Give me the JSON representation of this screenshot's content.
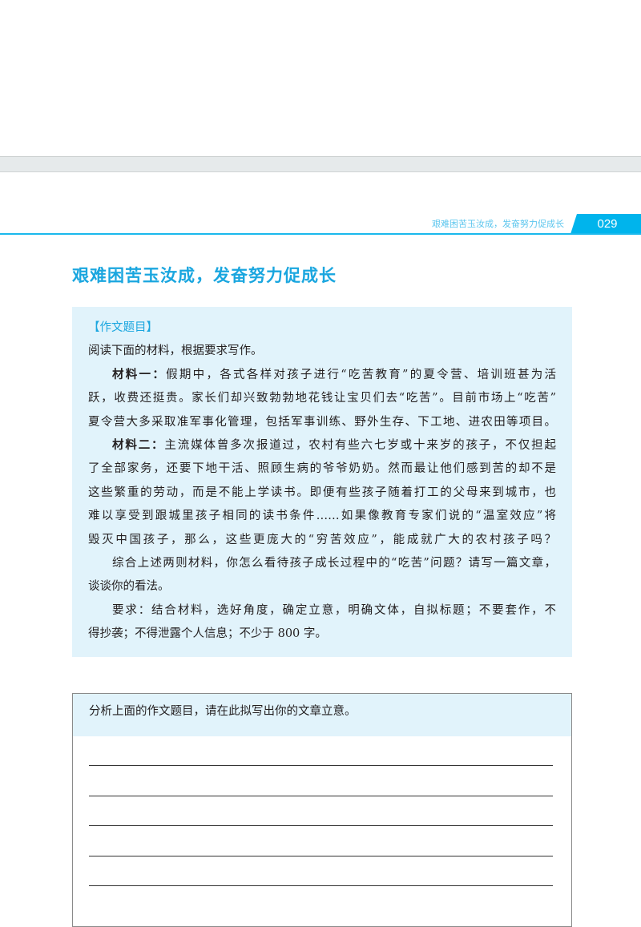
{
  "header": {
    "running_title": "艰难困苦玉汝成，发奋努力促成长",
    "page_number": "029"
  },
  "title": "艰难困苦玉汝成，发奋努力促成长",
  "prompt": {
    "heading": "【作文题目】",
    "intro": "阅读下面的材料，根据要求写作。",
    "material1_label": "材料一：",
    "material1_lines": [
      "假期中，各式各样对孩子进行“吃苦教育”的夏令营、培训班甚为活",
      "跃，收费还挺贵。家长们却兴致勃勃地花钱让宝贝们去“吃苦”。目前市场上“吃苦”",
      "夏令营大多采取准军事化管理，包括军事训练、野外生存、下工地、进农田等项目。"
    ],
    "material2_label": "材料二：",
    "material2_lines": [
      "主流媒体曾多次报道过，农村有些六七岁或十来岁的孩子，不仅担起",
      "了全部家务，还要下地干活、照顾生病的爷爷奶奶。然而最让他们感到苦的却不是",
      "这些繁重的劳动，而是不能上学读书。即便有些孩子随着打工的父母来到城市，也",
      "难以享受到跟城里孩子相同的读书条件……如果像教育专家们说的“温室效应”将",
      "毁灭中国孩子，那么，这些更庞大的“穷苦效应”，能成就广大的农村孩子吗？"
    ],
    "task_lines": [
      "综合上述两则材料，你怎么看待孩子成长过程中的“吃苦”问题？请写一篇文章，",
      "谈谈你的看法。"
    ],
    "req_lines": [
      "要求：结合材料，选好角度，确定立意，明确文体，自拟标题；不要套作，不",
      "得抄袭；不得泄露个人信息；不少于 800 字。"
    ]
  },
  "exercise": {
    "instruction": "分析上面的作文题目，请在此拟写出你的文章立意。"
  }
}
